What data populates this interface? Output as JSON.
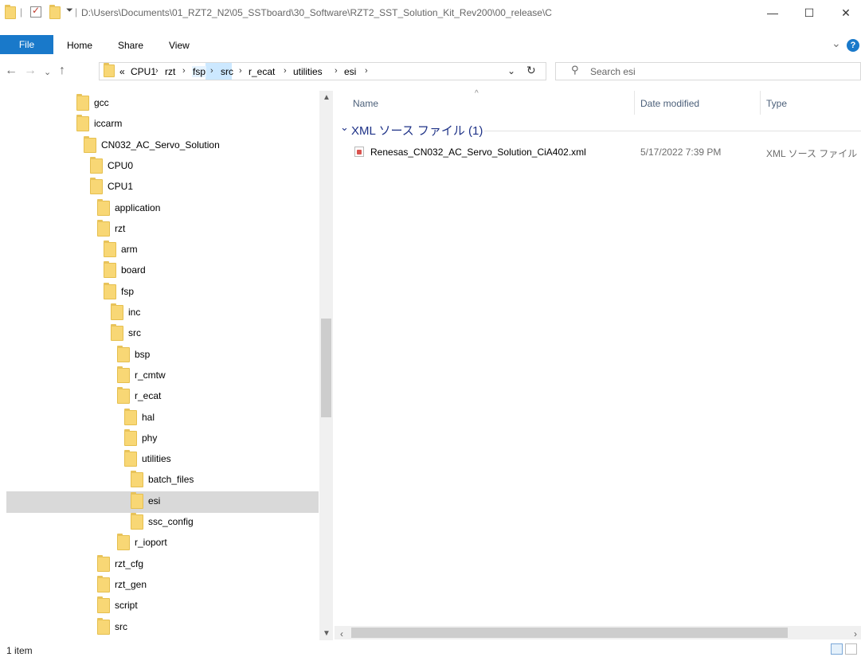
{
  "window": {
    "path_title": "D:\\Users\\Documents\\01_RZT2_N2\\05_SSTboard\\30_Software\\RZT2_SST_Solution_Kit_Rev200\\00_release\\C",
    "minimize": "—",
    "maximize": "☐",
    "close": "✕"
  },
  "ribbon": {
    "file": "File",
    "home": "Home",
    "share": "Share",
    "view": "View",
    "expand": "⌄",
    "help": "?"
  },
  "address": {
    "crumbs": [
      "CPU1",
      "rzt",
      "fsp",
      "src",
      "r_ecat",
      "utilities",
      "esi"
    ],
    "overflow": "«",
    "search_placeholder": "Search esi"
  },
  "tree": [
    {
      "label": "gcc",
      "indent": 0
    },
    {
      "label": "iccarm",
      "indent": 0
    },
    {
      "label": "CN032_AC_Servo_Solution",
      "indent": 1
    },
    {
      "label": "CPU0",
      "indent": 2
    },
    {
      "label": "CPU1",
      "indent": 2
    },
    {
      "label": "application",
      "indent": 3
    },
    {
      "label": "rzt",
      "indent": 3
    },
    {
      "label": "arm",
      "indent": 4
    },
    {
      "label": "board",
      "indent": 4
    },
    {
      "label": "fsp",
      "indent": 4
    },
    {
      "label": "inc",
      "indent": 5
    },
    {
      "label": "src",
      "indent": 5
    },
    {
      "label": "bsp",
      "indent": 6
    },
    {
      "label": "r_cmtw",
      "indent": 6
    },
    {
      "label": "r_ecat",
      "indent": 6
    },
    {
      "label": "hal",
      "indent": 7
    },
    {
      "label": "phy",
      "indent": 7
    },
    {
      "label": "utilities",
      "indent": 7
    },
    {
      "label": "batch_files",
      "indent": 8
    },
    {
      "label": "esi",
      "indent": 8
    },
    {
      "label": "ssc_config",
      "indent": 8
    },
    {
      "label": "r_ioport",
      "indent": 6
    },
    {
      "label": "rzt_cfg",
      "indent": 3
    },
    {
      "label": "rzt_gen",
      "indent": 3
    },
    {
      "label": "script",
      "indent": 3
    },
    {
      "label": "src",
      "indent": 3
    }
  ],
  "columns": {
    "name": "Name",
    "date": "Date modified",
    "type": "Type"
  },
  "group": {
    "label": "XML ソース ファイル (1)"
  },
  "files": [
    {
      "name": "Renesas_CN032_AC_Servo_Solution_CiA402.xml",
      "date": "5/17/2022 7:39 PM",
      "type": "XML ソース ファイル"
    }
  ],
  "status": {
    "count": "1 item"
  }
}
